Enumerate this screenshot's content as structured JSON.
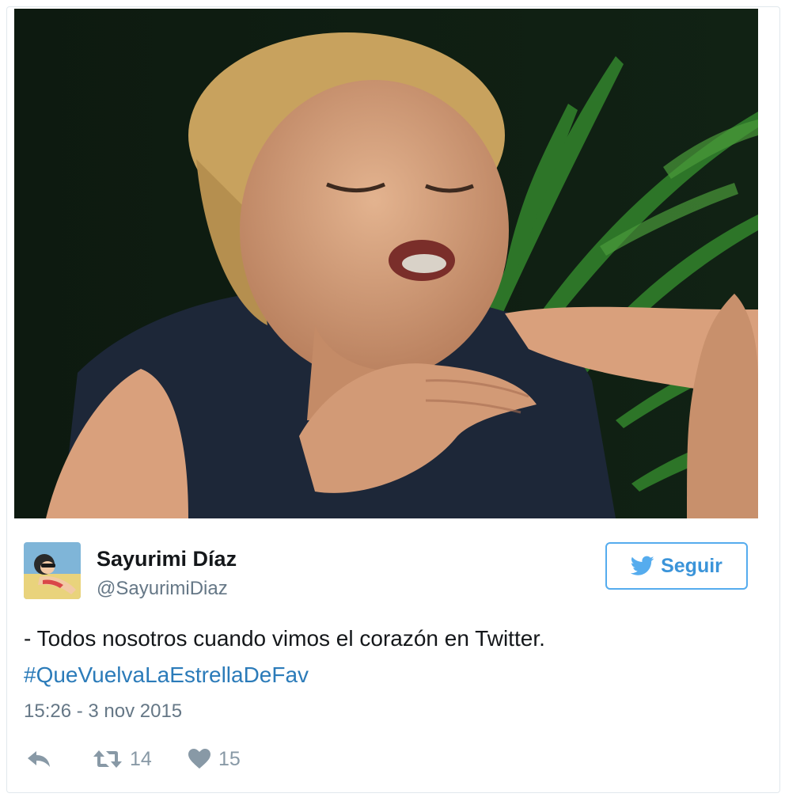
{
  "colors": {
    "accent": "#55acee",
    "link": "#2b7bb9",
    "text": "#14171a",
    "muted": "#657786",
    "icon": "#8899a6"
  },
  "tweet": {
    "media": {
      "icon": "photo-image"
    },
    "author": {
      "name": "Sayurimi Díaz",
      "handle": "@SayurimiDiaz",
      "avatar_icon": "avatar-image"
    },
    "follow_button": {
      "label": "Seguir",
      "icon": "twitter-bird-icon"
    },
    "text": "- Todos nosotros cuando vimos el corazón en Twitter.",
    "hashtag": "#QueVuelvaLaEstrellaDeFav",
    "timestamp": "15:26 - 3 nov 2015",
    "actions": {
      "reply": {
        "icon": "reply-icon"
      },
      "retweet": {
        "icon": "retweet-icon",
        "count": "14"
      },
      "like": {
        "icon": "heart-icon",
        "count": "15"
      }
    }
  }
}
